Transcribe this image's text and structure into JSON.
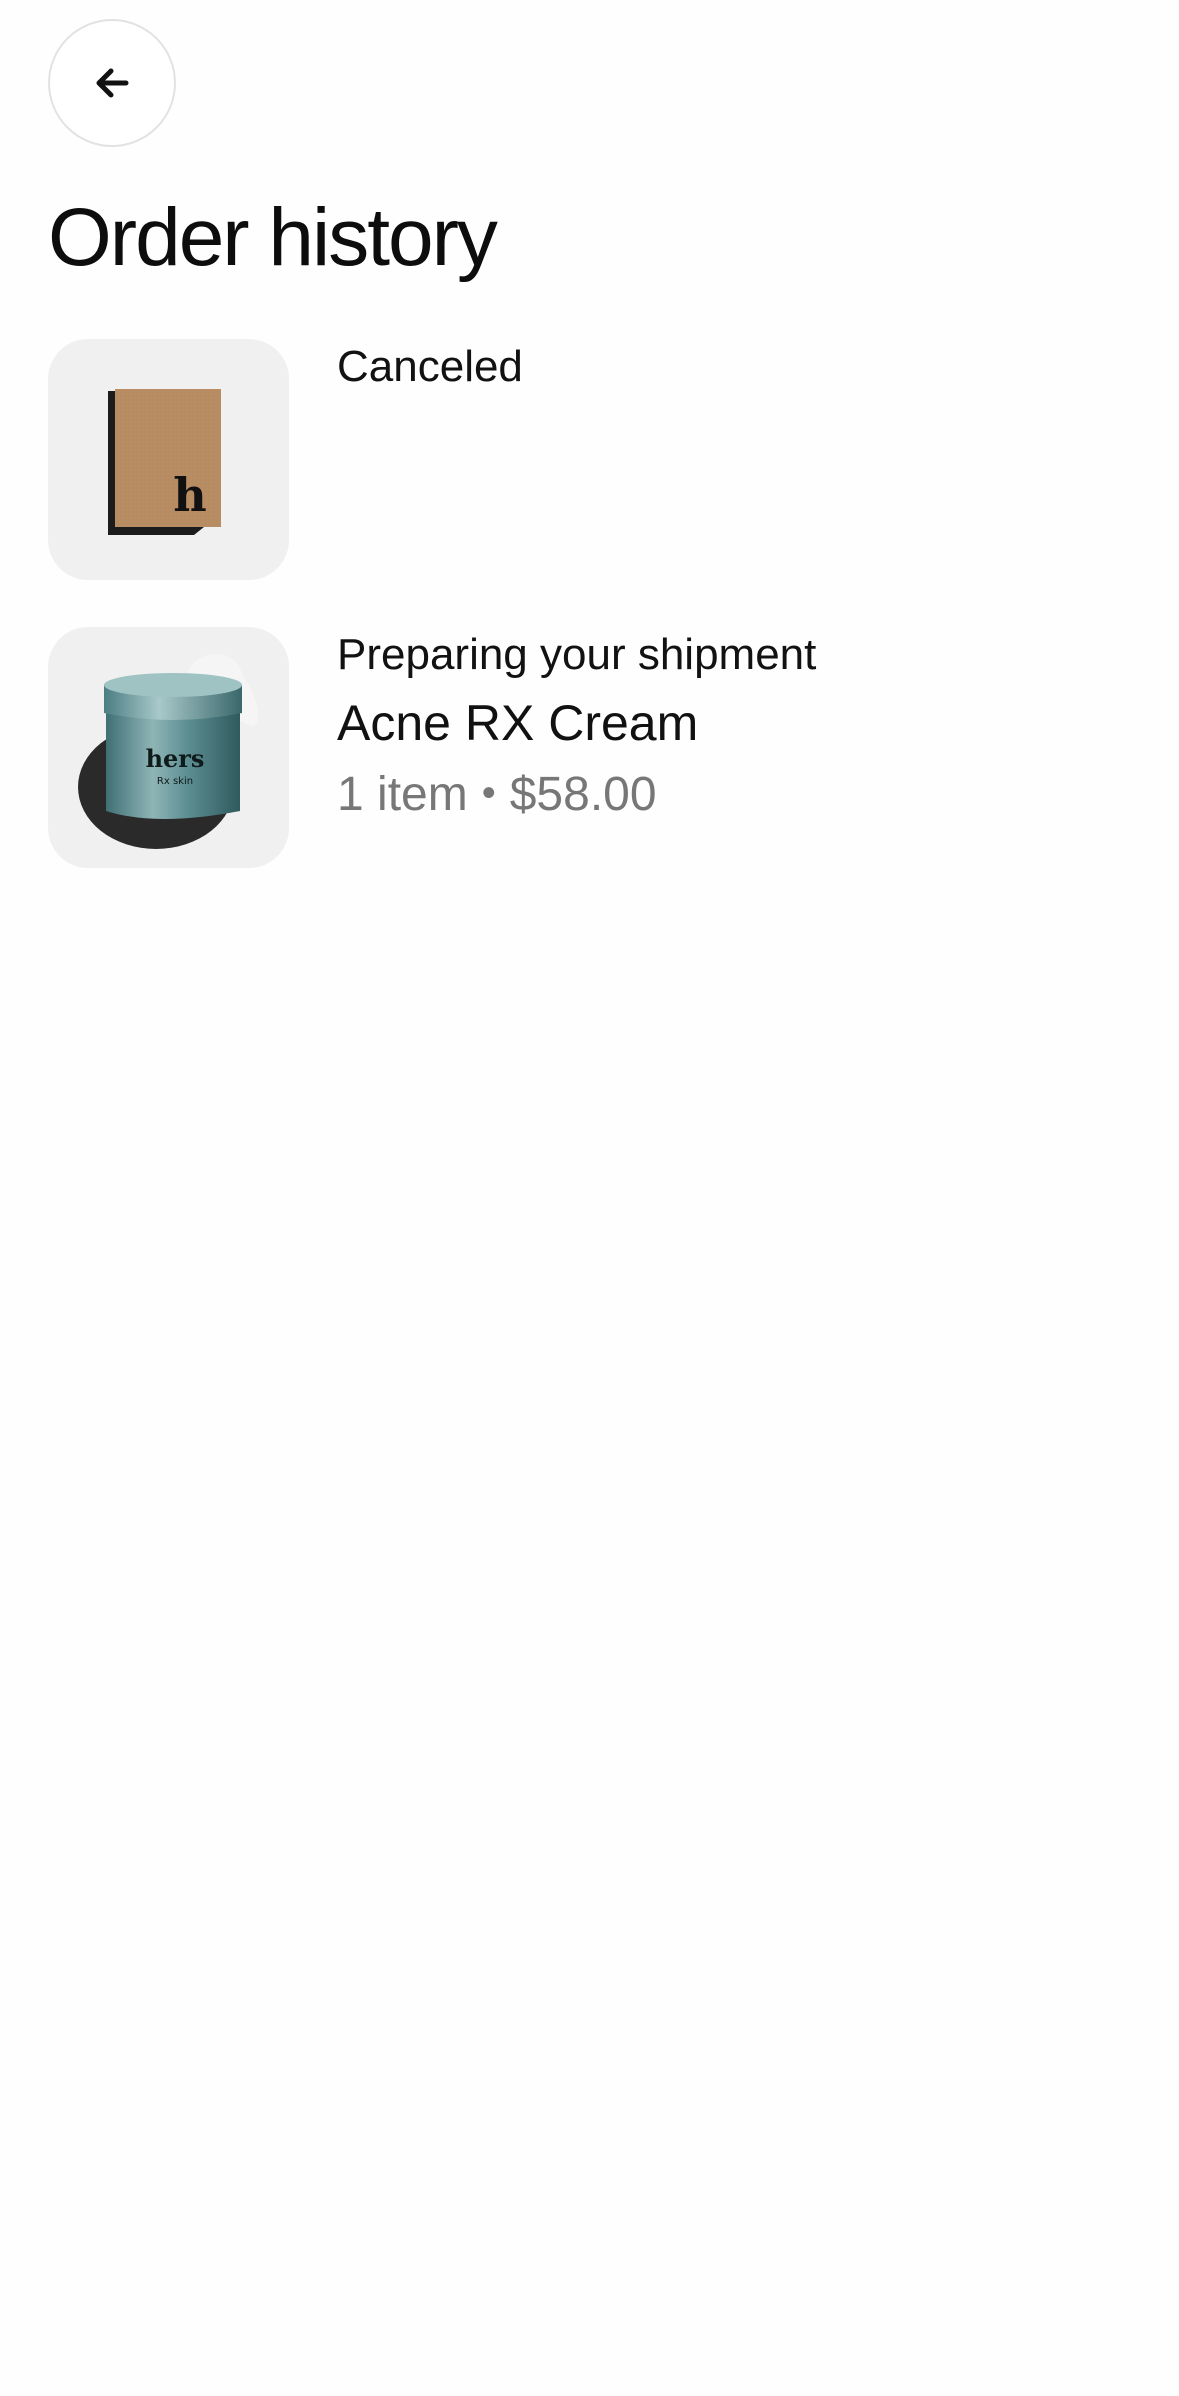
{
  "header": {
    "back_icon": "arrow-left-icon",
    "title": "Order history"
  },
  "orders": [
    {
      "status": "Canceled",
      "thumbnail": "hers-box-icon",
      "box_letter": "h"
    },
    {
      "status": "Preparing your shipment",
      "product": "Acne RX Cream",
      "item_count": "1 item",
      "separator": "•",
      "price": "$58.00",
      "thumbnail": "rx-cream-jar-icon",
      "jar_brand": "hers",
      "jar_sub": "Rx skin"
    }
  ],
  "colors": {
    "background": "#fefefe",
    "card": "#f0f0f0",
    "muted_text": "#777777",
    "box_tan": "#b88d63",
    "jar_teal": "#5e8f93"
  }
}
